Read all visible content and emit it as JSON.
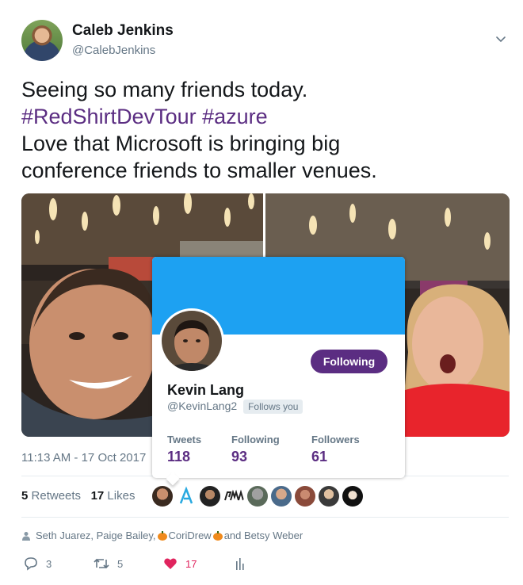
{
  "tweet": {
    "author_name": "Caleb Jenkins",
    "author_handle": "@CalebJenkins",
    "line1": "Seeing so many friends today.",
    "hashtag1": "#RedShirtDevTour",
    "hashtag2": "#azure",
    "line3": "Love that Microsoft is bringing big",
    "line4": "conference friends to smaller venues.",
    "timestamp": "11:13 AM - 17 Oct 2017"
  },
  "engagement": {
    "retweets_count": "5",
    "retweets_label": "Retweets",
    "likes_count": "17",
    "likes_label": "Likes",
    "faces": [
      "face-1",
      "face-azure",
      "face-3",
      "face-pma",
      "face-5",
      "face-6",
      "face-7",
      "face-8",
      "face-9"
    ],
    "liked_by": {
      "prefix": "Seth Juarez, Paige Bailey, ",
      "middle": "CoriDrew",
      "suffix": " and Betsy Weber"
    }
  },
  "actions": {
    "reply_count": "3",
    "retweet_count": "5",
    "like_count": "17"
  },
  "hovercard": {
    "name": "Kevin Lang",
    "handle": "@KevinLang2",
    "follows_you": "Follows you",
    "follow_button": "Following",
    "tweets_label": "Tweets",
    "tweets_value": "118",
    "following_label": "Following",
    "following_value": "93",
    "followers_label": "Followers",
    "followers_value": "61"
  },
  "colors": {
    "accent": "#5b2d82",
    "banner": "#1da1f2",
    "like": "#e0245e",
    "muted": "#657786"
  },
  "icons": [
    "chevron-down-icon",
    "reply-icon",
    "retweet-icon",
    "heart-icon",
    "analytics-icon",
    "person-icon",
    "pumpkin-icon"
  ]
}
